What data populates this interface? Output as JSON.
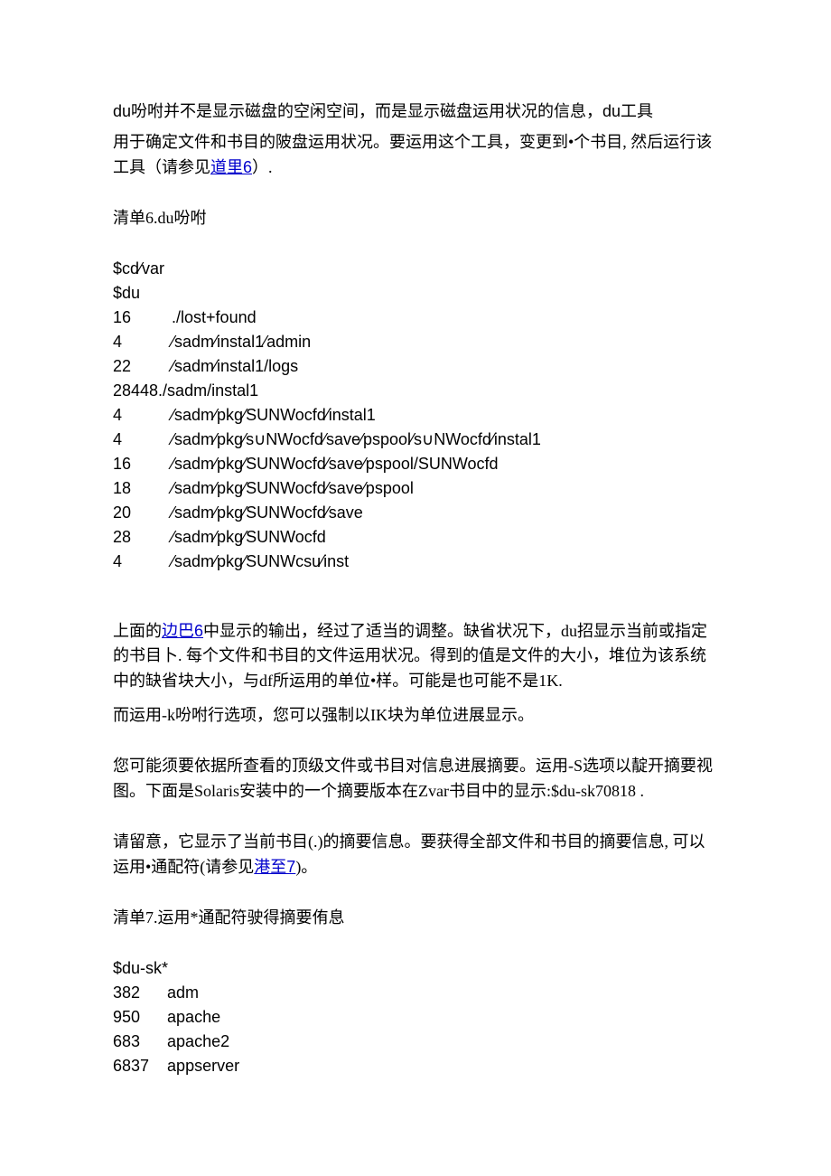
{
  "p1_a": "du吩咐并不是显示磁盘的空闲空间，而是显示磁盘运用状况的信息，du工具",
  "p2_a": "用于确定文件和书目的陂盘运用状况。要运用这个工具，变更到•个书目, 然后运行该工具（请参见",
  "p2_link": "道里6",
  "p2_b": "）.",
  "listing6_title": "清单6.du吩咐",
  "code_block_1": "$cd⁄var\n$du\n16         ./lost+found\n4           ⁄sadm⁄instal1⁄admin\n22         ⁄sadm⁄instal1/logs\n28448./sadm/instal1\n4           ⁄sadm⁄pkg⁄SUNWocfd⁄instal1\n4           ⁄sadm⁄pkg⁄s∪NWocfd⁄save⁄pspool⁄s∪NWocfd⁄instal1\n16         ⁄sadm⁄pkg⁄SUNWocfd⁄save⁄pspool/SUNWocfd\n18         ⁄sadm⁄pkg⁄SUNWocfd⁄save⁄pspool\n20         ⁄sadm⁄pkg⁄SUNWocfd⁄save\n28         ⁄sadm⁄pkg⁄SUNWocfd\n4           ⁄sadm⁄pkg⁄SUNWcsu⁄inst",
  "p3_a": "上面的",
  "p3_link": "边巴6",
  "p3_b": "中显示的输出，经过了适当的调整。缺省状况下，du招显示当前或指定的书目卜. 每个文件和书目的文件运用状况。得到的值是文件的大小，堆位为该系统中的缺省块大小，与df所运用的单位•样。可能是也可能不是1K.",
  "p4": "而运用-k吩咐行选项，您可以强制以IK块为单位进展显示。",
  "p5": "您可能须要依据所查看的顶级文件或书目对信息进展摘要。运用-S选项以靛开摘要视图。下面是Solaris安装中的一个摘要版本在Zvar书目中的显示:$du-sk70818   .",
  "p6_a": "请留意，它显示了当前书目(.)的摘要信息。要获得全部文件和书目的摘要信息, 可以运用•通配符(请参见",
  "p6_link": "港至7",
  "p6_b": ")。",
  "listing7_title": "清单7.运用*通配符驶得摘要侑息",
  "code_block_2": "$du-sk*\n382      adm\n950      apache\n683      apache2\n6837    appserver"
}
